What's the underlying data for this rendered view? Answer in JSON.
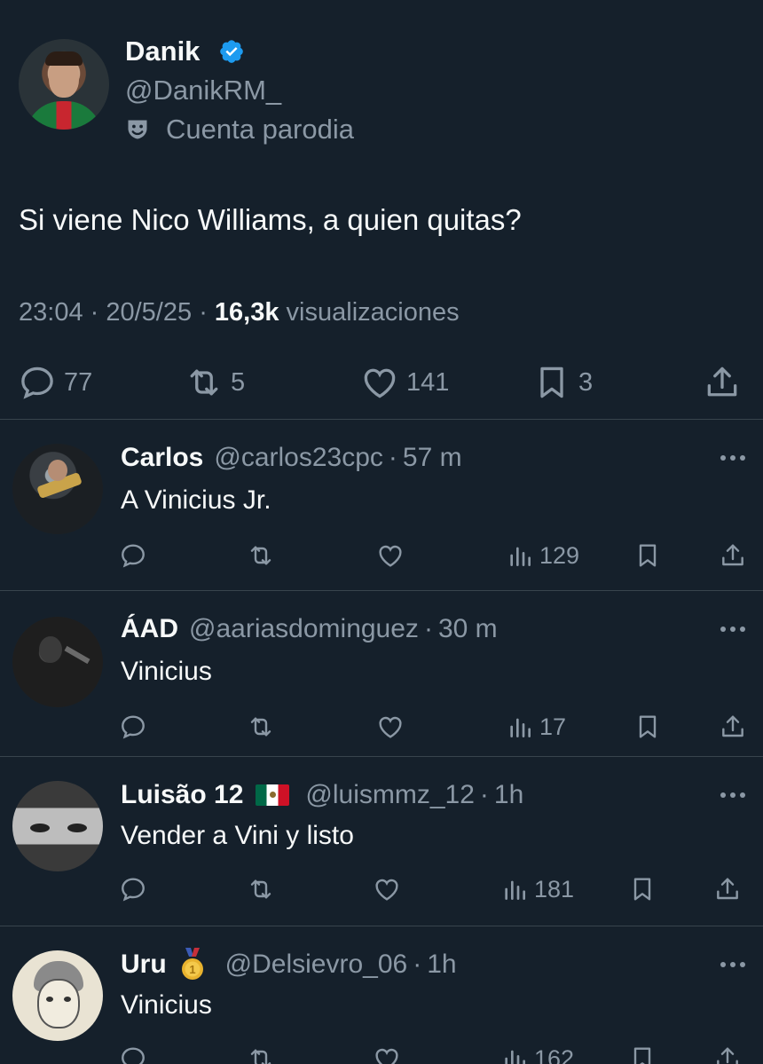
{
  "tweet": {
    "author_name": "Danik",
    "author_handle": "@DanikRM_",
    "parody_label": "Cuenta parodia",
    "text": "Si viene Nico Williams, a quien quitas?",
    "time": "23:04",
    "date": "20/5/25",
    "views": "16,3k",
    "views_label": "visualizaciones",
    "replies": "77",
    "retweets": "5",
    "likes": "141",
    "bookmarks": "3"
  },
  "replies": [
    {
      "name": "Carlos",
      "handle": "@carlos23cpc",
      "time": "57 m",
      "text": "A Vinicius Jr.",
      "views": "129"
    },
    {
      "name": "ÁAD",
      "handle": "@aariasdominguez",
      "time": "30 m",
      "text": "Vinicius",
      "views": "17"
    },
    {
      "name": "Luisão 12",
      "handle": "@luismmz_12",
      "time": "1h",
      "text": "Vender a Vini y listo",
      "views": "181",
      "badge": "mexico-flag"
    },
    {
      "name": "Uru",
      "handle": "@Delsievro_06",
      "time": "1h",
      "text": "Vinicius",
      "views": "162",
      "badge": "medal"
    }
  ],
  "colors": {
    "background": "#15202b",
    "text": "#f7f9f9",
    "muted": "#8b98a5",
    "verified": "#1d9bf0",
    "divider": "#38444d"
  },
  "icons": [
    "verified-badge-icon",
    "parody-mask-icon",
    "reply-icon",
    "retweet-icon",
    "like-icon",
    "bookmark-icon",
    "share-icon",
    "views-icon",
    "more-icon"
  ]
}
